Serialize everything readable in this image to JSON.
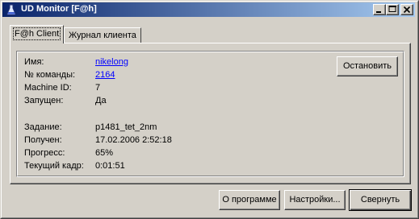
{
  "window": {
    "title": "UD Monitor [F@h]",
    "icon": "flask-icon",
    "controls": [
      "minimize-icon",
      "maximize-icon",
      "close-icon"
    ]
  },
  "tabs": [
    {
      "label": "F@h Client",
      "active": true
    },
    {
      "label": "Журнал клиента",
      "active": false
    }
  ],
  "info": {
    "name_label": "Имя:",
    "name_value": "nikelong",
    "team_label": "№ команды:",
    "team_value": "2164",
    "machine_label": "Machine ID:",
    "machine_value": "7",
    "running_label": "Запущен:",
    "running_value": "Да",
    "task_label": "Задание:",
    "task_value": "p1481_tet_2nm",
    "received_label": "Получен:",
    "received_value": "17.02.2006 2:52:18",
    "progress_label": "Прогресс:",
    "progress_value": "65%",
    "frame_label": "Текущий кадр:",
    "frame_value": "0:01:51"
  },
  "buttons": {
    "stop": "Остановить",
    "about": "О программе",
    "settings": "Настройки...",
    "minimize": "Свернуть"
  },
  "colors": {
    "titlebar_start": "#0a246a",
    "titlebar_end": "#a6caf0",
    "link": "#0000ff",
    "face": "#d4d0c8"
  }
}
